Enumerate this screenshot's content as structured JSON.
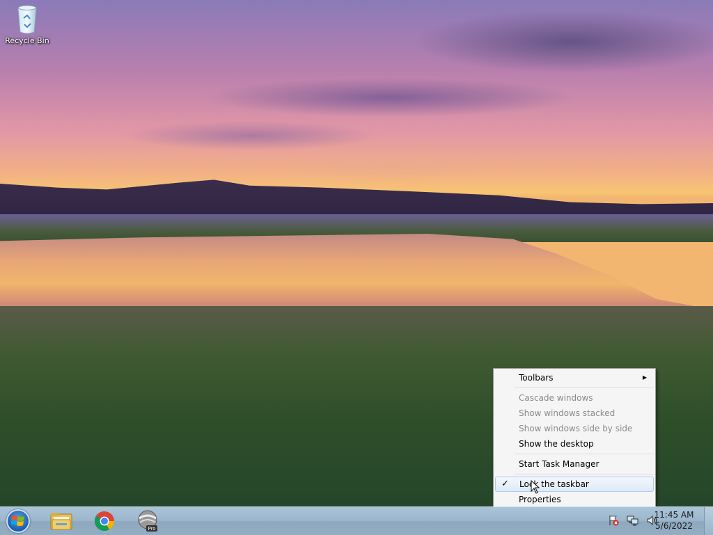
{
  "desktop": {
    "icons": [
      {
        "label": "Recycle Bin",
        "icon": "recycle-bin-icon"
      }
    ]
  },
  "taskbar": {
    "start": {
      "icon": "windows-logo-icon"
    },
    "pinned": [
      {
        "name": "Windows Explorer",
        "icon": "folder-icon"
      },
      {
        "name": "Google Chrome",
        "icon": "chrome-icon"
      },
      {
        "name": "Google Earth Pro",
        "icon": "google-earth-pro-icon"
      }
    ],
    "tray": [
      {
        "icon": "action-center-error-icon"
      },
      {
        "icon": "network-icon"
      },
      {
        "icon": "volume-icon"
      }
    ],
    "clock": {
      "time": "11:45 AM",
      "date": "5/6/2022"
    }
  },
  "context_menu": {
    "items": [
      {
        "label": "Toolbars",
        "submenu": true
      },
      {
        "label": "Cascade windows",
        "disabled": true
      },
      {
        "label": "Show windows stacked",
        "disabled": true
      },
      {
        "label": "Show windows side by side",
        "disabled": true
      },
      {
        "label": "Show the desktop"
      },
      {
        "label": "Start Task Manager"
      },
      {
        "label": "Lock the taskbar",
        "checked": true,
        "highlighted": true
      },
      {
        "label": "Properties"
      }
    ]
  },
  "colors": {
    "taskbar": "#9cb6cc",
    "menu_background": "#f5f5f5",
    "menu_highlight": "#dfeaf7",
    "disabled_text": "#8a8a8a"
  }
}
